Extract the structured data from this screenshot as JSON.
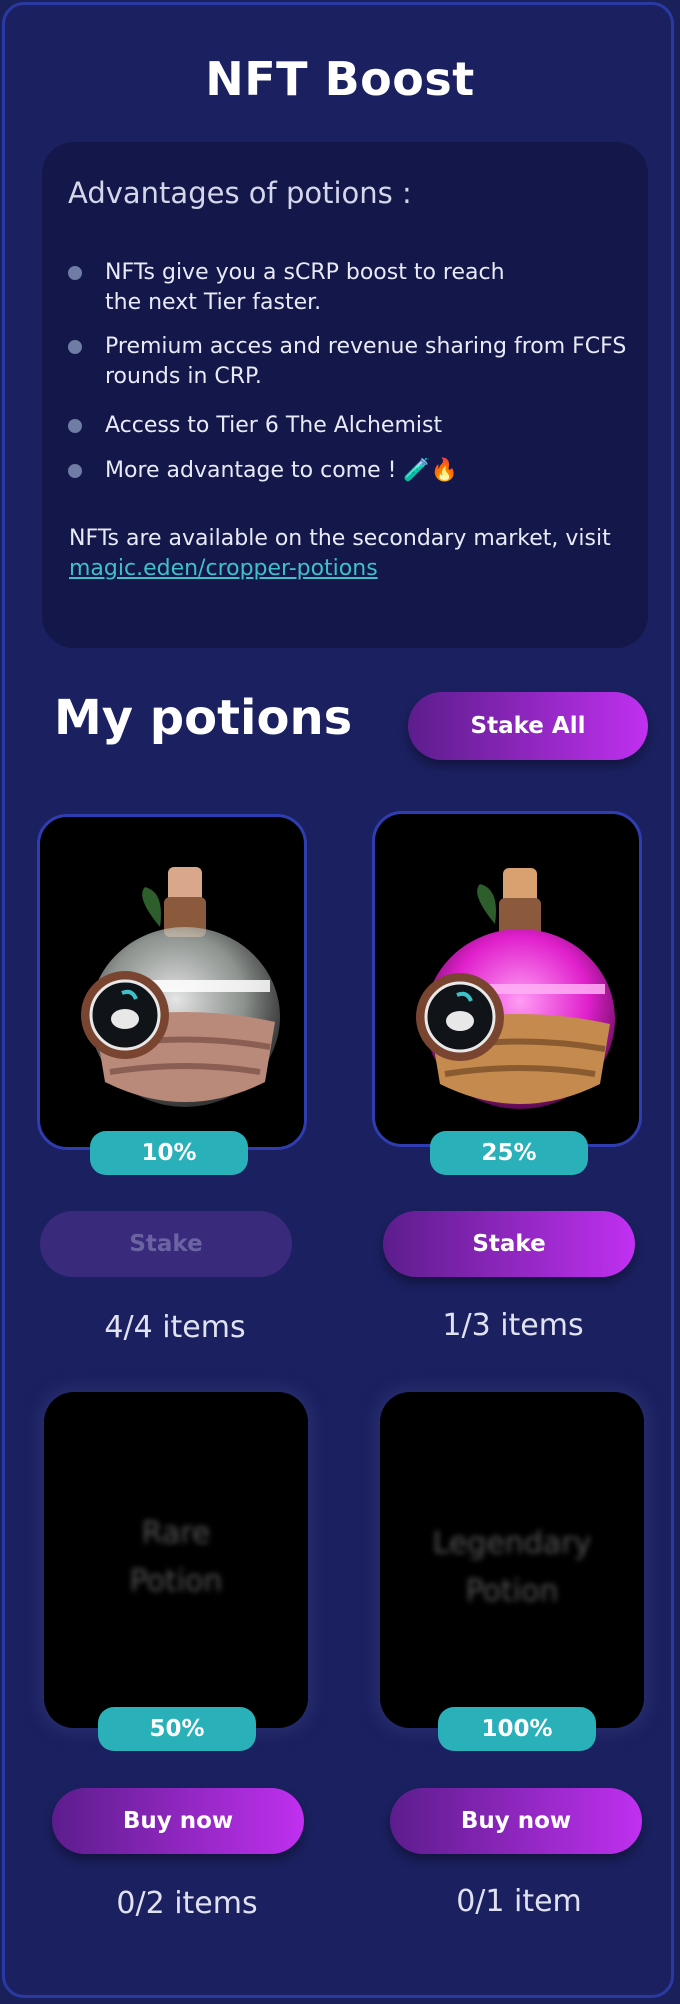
{
  "header": {
    "title": "NFT Boost"
  },
  "advantages": {
    "heading": "Advantages of potions :",
    "items": [
      "NFTs give you a sCRP boost to reach the next Tier faster.",
      "Premium acces and revenue sharing from FCFS rounds in CRP.",
      "Access to Tier 6 The Alchemist",
      "More advantage to come ! 🧪🔥"
    ],
    "available_text": "NFTs are available on the secondary market, visit",
    "link_text": "magic.eden/cropper-potions"
  },
  "potions": {
    "heading": "My potions",
    "stake_all_label": "Stake All",
    "cards": [
      {
        "boost": "10%",
        "action": "Stake",
        "action_enabled": false,
        "count": "4/4 items",
        "liquid_color": "#e8ece8"
      },
      {
        "boost": "25%",
        "action": "Stake",
        "action_enabled": true,
        "count": "1/3 items",
        "liquid_color": "#ff2fe0"
      },
      {
        "name": "Rare Potion",
        "boost": "50%",
        "action": "Buy now",
        "count": "0/2 items"
      },
      {
        "name": "Legendary Potion",
        "boost": "100%",
        "action": "Buy now",
        "count": "0/1 item"
      }
    ]
  }
}
